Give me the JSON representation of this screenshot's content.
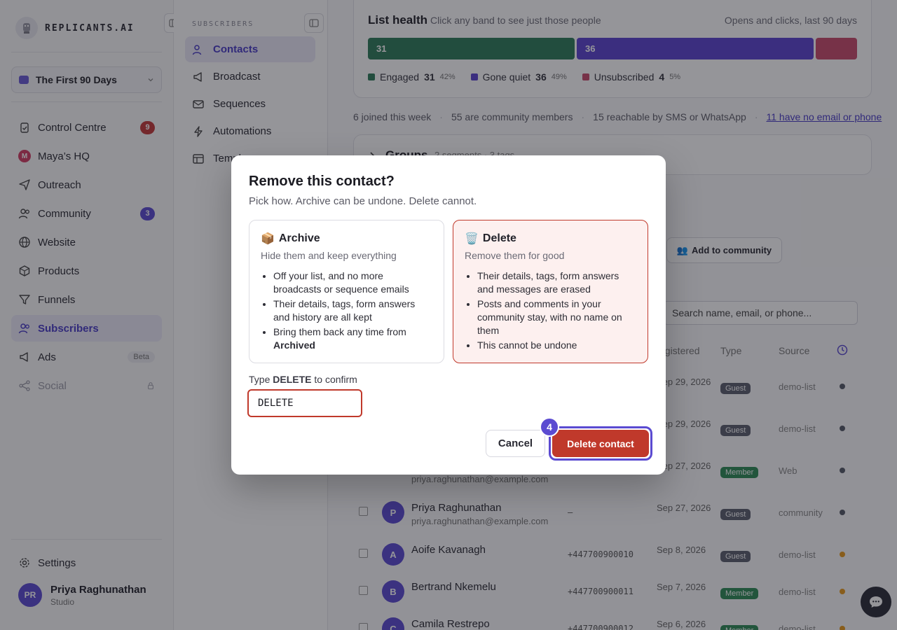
{
  "brand": {
    "name": "REPLICANTS.AI"
  },
  "workspace": {
    "name": "The First 90 Days"
  },
  "sidebar": {
    "items": [
      {
        "label": "Control Centre",
        "badge": "9"
      },
      {
        "label": "Maya’s HQ",
        "avatar": "M"
      },
      {
        "label": "Outreach"
      },
      {
        "label": "Community",
        "badge": "3"
      },
      {
        "label": "Website"
      },
      {
        "label": "Products"
      },
      {
        "label": "Funnels"
      },
      {
        "label": "Subscribers"
      },
      {
        "label": "Ads",
        "tag": "Beta"
      },
      {
        "label": "Social"
      }
    ],
    "settings": "Settings",
    "user": {
      "initials": "PR",
      "name": "Priya Raghunathan",
      "role": "Studio"
    }
  },
  "subnav": {
    "title": "SUBSCRIBERS",
    "items": [
      "Contacts",
      "Broadcast",
      "Sequences",
      "Automations",
      "Templ"
    ]
  },
  "health": {
    "title": "List health",
    "hint": "Click any band to see just those people",
    "range": "Opens and clicks, last 90 days",
    "bands": [
      {
        "label": "Engaged",
        "count": "31",
        "pct": "42%",
        "bar_text": "31",
        "color": "#2e7d5a"
      },
      {
        "label": "Gone quiet",
        "count": "36",
        "pct": "49%",
        "bar_text": "36",
        "color": "#5c44cf"
      },
      {
        "label": "Unsubscribed",
        "count": "4",
        "pct": "5%",
        "bar_text": "",
        "color": "#c94c6c"
      }
    ]
  },
  "stats": {
    "joined": "6 joined this week",
    "community": "55 are community members",
    "reachable": "15 reachable by SMS or WhatsApp",
    "missing": "11 have no email or phone"
  },
  "groups": {
    "title": "Groups",
    "meta": "2 segments · 3 tags"
  },
  "toolbar": {
    "add_community": "Add to community"
  },
  "search": {
    "placeholder": "Search name, email, or phone..."
  },
  "table": {
    "headers": {
      "registered": "egistered",
      "type": "Type",
      "source": "Source"
    },
    "rows": [
      {
        "initial": "",
        "name": "",
        "email": "",
        "phone": "",
        "date": "Sep 29, 2026",
        "type": "Guest",
        "source": "demo-list",
        "status": "grey"
      },
      {
        "initial": "",
        "name": "",
        "email": "",
        "phone": "",
        "date": "Sep 29, 2026",
        "type": "Guest",
        "source": "demo-list",
        "status": "grey"
      },
      {
        "initial": "",
        "name": "",
        "email": "priya.raghunathan@example.com",
        "phone": "",
        "date": "Sep 27, 2026",
        "type": "Member",
        "source": "Web",
        "status": "grey"
      },
      {
        "initial": "P",
        "name": "Priya Raghunathan",
        "email": "priya.raghunathan@example.com",
        "phone": "—",
        "date": "Sep 27, 2026",
        "type": "Guest",
        "source": "community",
        "status": "grey"
      },
      {
        "initial": "A",
        "name": "Aoife Kavanagh",
        "email": "",
        "phone": "+447700900010",
        "date": "Sep 8, 2026",
        "type": "Guest",
        "source": "demo-list",
        "status": "orange"
      },
      {
        "initial": "B",
        "name": "Bertrand Nkemelu",
        "email": "",
        "phone": "+447700900011",
        "date": "Sep 7, 2026",
        "type": "Member",
        "source": "demo-list",
        "status": "orange"
      },
      {
        "initial": "C",
        "name": "Camila Restrepo",
        "email": "",
        "phone": "+447700900012",
        "date": "Sep 6, 2026",
        "type": "Member",
        "source": "demo-list",
        "status": "orange"
      }
    ]
  },
  "modal": {
    "title": "Remove this contact?",
    "subtitle": "Pick how. Archive can be undone. Delete cannot.",
    "archive": {
      "icon": "📦",
      "title": "Archive",
      "desc": "Hide them and keep everything",
      "points": [
        "Off your list, and no more broadcasts or sequence emails",
        "Their details, tags, form answers and history are all kept"
      ],
      "last_point_prefix": "Bring them back any time from",
      "last_point_bold": "Archived"
    },
    "delete": {
      "icon": "🗑️",
      "title": "Delete",
      "desc": "Remove them for good",
      "points": [
        "Their details, tags, form answers and messages are erased",
        "Posts and comments in your community stay, with no name on them",
        "This cannot be undone"
      ]
    },
    "confirm": {
      "prefix": "Type",
      "keyword": "DELETE",
      "suffix": "to confirm",
      "value": "DELETE"
    },
    "cancel": "Cancel",
    "delete_button": "Delete contact",
    "step": "4"
  }
}
